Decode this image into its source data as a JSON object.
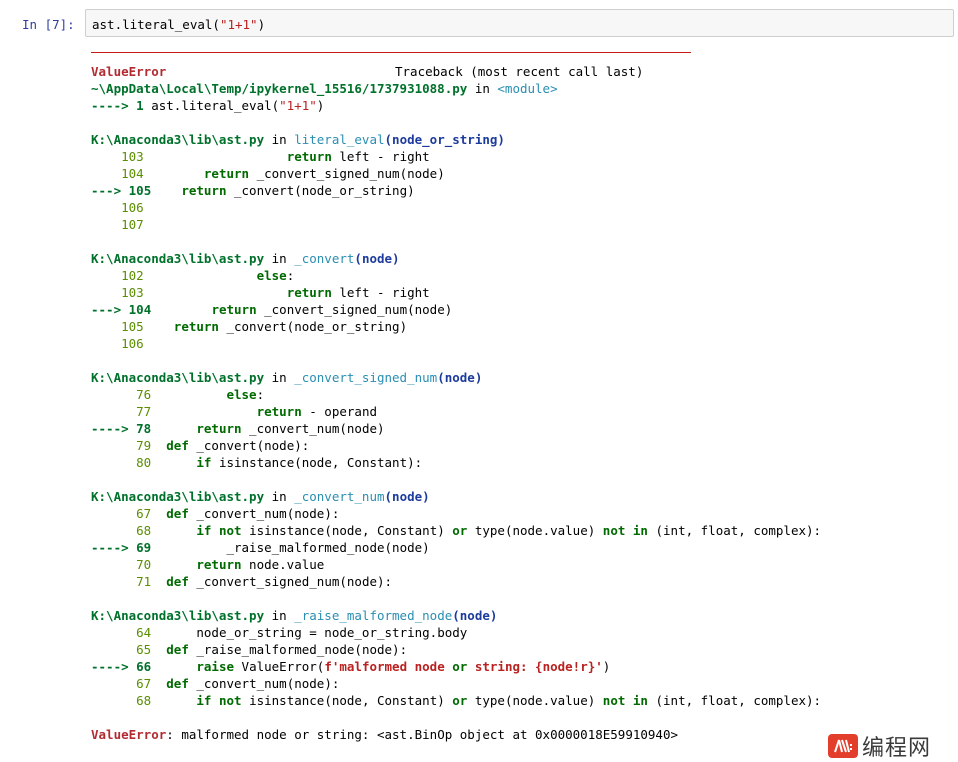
{
  "cell": {
    "prompt": "In  [7]:",
    "input_prefix": "ast.literal_eval(",
    "input_string": "\"1+1\"",
    "input_suffix": ")"
  },
  "traceback": {
    "header_error": "ValueError",
    "header_text": "Traceback (most recent call last)",
    "module_path": "~\\AppData\\Local\\Temp/ipykernel_15516/1737931088.py",
    "module_in": " in ",
    "module_name": "<module>",
    "module_arrow": "----> 1 ",
    "module_code_prefix": "ast.literal_eval(",
    "module_code_string": "\"1+1\"",
    "module_code_suffix": ")",
    "frames": [
      {
        "path": "K:\\Anaconda3\\lib\\ast.py",
        "func": "literal_eval",
        "args": "(node_or_string)",
        "lines": [
          {
            "no": "103",
            "current": false,
            "code": "                   return left - right"
          },
          {
            "no": "104",
            "current": false,
            "code": "        return _convert_signed_num(node)"
          },
          {
            "no": "105",
            "current": true,
            "code": "    return _convert(node_or_string)"
          },
          {
            "no": "106",
            "current": false,
            "code": ""
          },
          {
            "no": "107",
            "current": false,
            "code": ""
          }
        ]
      },
      {
        "path": "K:\\Anaconda3\\lib\\ast.py",
        "func": "_convert",
        "args": "(node)",
        "lines": [
          {
            "no": "102",
            "current": false,
            "code": "               else:"
          },
          {
            "no": "103",
            "current": false,
            "code": "                   return left - right"
          },
          {
            "no": "104",
            "current": true,
            "code": "        return _convert_signed_num(node)"
          },
          {
            "no": "105",
            "current": false,
            "code": "    return _convert(node_or_string)"
          },
          {
            "no": "106",
            "current": false,
            "code": ""
          }
        ]
      },
      {
        "path": "K:\\Anaconda3\\lib\\ast.py",
        "func": "_convert_signed_num",
        "args": "(node)",
        "lines": [
          {
            "no": "76",
            "current": false,
            "code": "          else:"
          },
          {
            "no": "77",
            "current": false,
            "code": "              return - operand"
          },
          {
            "no": "78",
            "current": true,
            "code": "      return _convert_num(node)"
          },
          {
            "no": "79",
            "current": false,
            "code": "  def _convert(node):"
          },
          {
            "no": "80",
            "current": false,
            "code": "      if isinstance(node, Constant):"
          }
        ]
      },
      {
        "path": "K:\\Anaconda3\\lib\\ast.py",
        "func": "_convert_num",
        "args": "(node)",
        "lines": [
          {
            "no": "67",
            "current": false,
            "code": "  def _convert_num(node):"
          },
          {
            "no": "68",
            "current": false,
            "code": "      if not isinstance(node, Constant) or type(node.value) not in (int, float, complex):"
          },
          {
            "no": "69",
            "current": true,
            "code": "          _raise_malformed_node(node)"
          },
          {
            "no": "70",
            "current": false,
            "code": "      return node.value"
          },
          {
            "no": "71",
            "current": false,
            "code": "  def _convert_signed_num(node):"
          }
        ]
      },
      {
        "path": "K:\\Anaconda3\\lib\\ast.py",
        "func": "_raise_malformed_node",
        "args": "(node)",
        "lines": [
          {
            "no": "64",
            "current": false,
            "code": "      node_or_string = node_or_string.body"
          },
          {
            "no": "65",
            "current": false,
            "code": "  def _raise_malformed_node(node):"
          },
          {
            "no": "66",
            "current": true,
            "code": "      raise ValueError(f'malformed node or string: {node!r}')"
          },
          {
            "no": "67",
            "current": false,
            "code": "  def _convert_num(node):"
          },
          {
            "no": "68",
            "current": false,
            "code": "      if not isinstance(node, Constant) or type(node.value) not in (int, float, complex):"
          }
        ]
      }
    ],
    "footer_error": "ValueError",
    "footer_message": ": malformed node or string: <ast.BinOp object at 0x0000018E59910940>"
  },
  "watermark": {
    "logo": "编程网 logo",
    "text": "编程网"
  },
  "colors": {
    "prompt": "#303f9f",
    "error": "#b22b31",
    "path": "#00712b",
    "func": "#2a8eb2",
    "line_number": "#5a8e00"
  }
}
